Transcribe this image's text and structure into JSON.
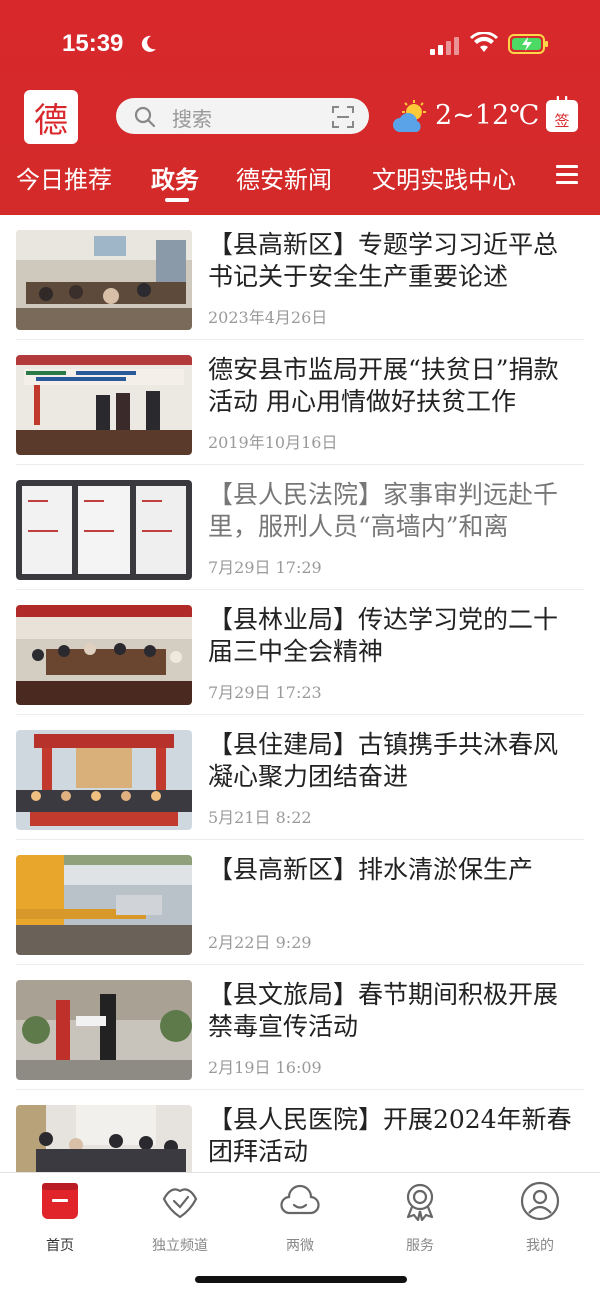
{
  "status": {
    "time": "15:39"
  },
  "header": {
    "logo_text": "德",
    "search_placeholder": "搜索",
    "weather": "2~12℃",
    "signin_label": "签"
  },
  "tabs": [
    {
      "label": "今日推荐"
    },
    {
      "label": "政务"
    },
    {
      "label": "德安新闻"
    },
    {
      "label": "文明实践中心"
    }
  ],
  "news": [
    {
      "title": "【县高新区】专题学习习近平总书记关于安全生产重要论述",
      "date": "2023年4月26日"
    },
    {
      "title": "德安县市监局开展“扶贫日”捐款活动 用心用情做好扶贫工作",
      "date": "2019年10月16日"
    },
    {
      "title": "【县人民法院】家事审判远赴千里，服刑人员“高墙内”和离",
      "date": "7月29日  17:29"
    },
    {
      "title": "【县林业局】传达学习党的二十届三中全会精神",
      "date": "7月29日  17:23"
    },
    {
      "title": "【县住建局】古镇携手共沐春风 凝心聚力团结奋进",
      "date": "5月21日  8:22"
    },
    {
      "title": "【县高新区】排水清淤保生产",
      "date": "2月22日  9:29"
    },
    {
      "title": "【县文旅局】春节期间积极开展禁毒宣传活动",
      "date": "2月19日  16:09"
    },
    {
      "title": "【县人民医院】开展2024年新春团拜活动",
      "date": ""
    }
  ],
  "tabbar": [
    {
      "label": "首页",
      "icon": "home-icon"
    },
    {
      "label": "独立频道",
      "icon": "handshake-icon"
    },
    {
      "label": "两微",
      "icon": "cloud-smile-icon"
    },
    {
      "label": "服务",
      "icon": "award-icon"
    },
    {
      "label": "我的",
      "icon": "user-icon"
    }
  ],
  "colors": {
    "brand_red": "#d8282c"
  }
}
